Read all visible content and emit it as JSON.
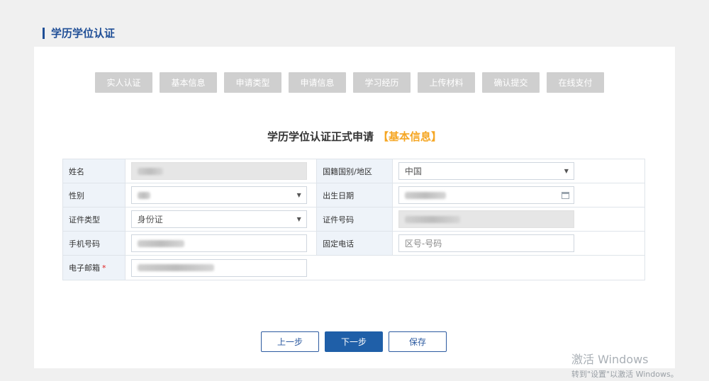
{
  "section_title": "学历学位认证",
  "steps": [
    "实人认证",
    "基本信息",
    "申请类型",
    "申请信息",
    "学习经历",
    "上传材料",
    "确认提交",
    "在线支付"
  ],
  "form": {
    "title": "学历学位认证正式申请",
    "title_accent": "【基本信息】",
    "fields": {
      "name_label": "姓名",
      "nationality_label": "国籍国别/地区",
      "nationality_value": "中国",
      "gender_label": "性别",
      "birthdate_label": "出生日期",
      "idtype_label": "证件类型",
      "idtype_value": "身份证",
      "idnumber_label": "证件号码",
      "mobile_label": "手机号码",
      "landline_label": "固定电话",
      "landline_placeholder": "区号-号码",
      "email_label": "电子邮箱",
      "email_required_mark": "*"
    }
  },
  "buttons": {
    "prev": "上一步",
    "next": "下一步",
    "save": "保存"
  },
  "watermark": {
    "line1": "激活 Windows",
    "line2": "转到\"设置\"以激活 Windows。"
  },
  "colors": {
    "accent": "#1f4e96",
    "step_bg": "#cfcfcf",
    "highlight": "#f5a623",
    "primary_button": "#1f5fa8"
  }
}
